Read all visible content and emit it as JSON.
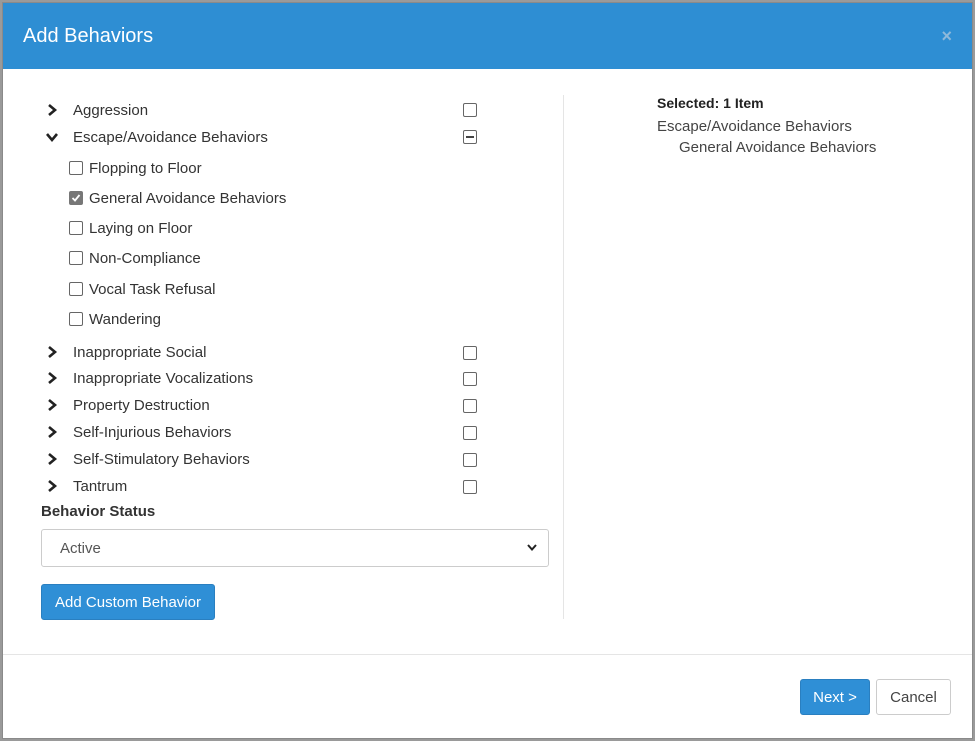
{
  "dialog": {
    "title": "Add Behaviors",
    "close_icon": "close-icon",
    "header_color": "#2e8ed3"
  },
  "tree": {
    "categories": [
      {
        "label": "Aggression",
        "expanded": false,
        "state": "unchecked"
      },
      {
        "label": "Escape/Avoidance Behaviors",
        "expanded": true,
        "state": "partial",
        "children": [
          {
            "label": "Flopping to Floor",
            "checked": false
          },
          {
            "label": "General Avoidance Behaviors",
            "checked": true
          },
          {
            "label": "Laying on Floor",
            "checked": false
          },
          {
            "label": "Non-Compliance",
            "checked": false
          },
          {
            "label": "Vocal Task Refusal",
            "checked": false
          },
          {
            "label": "Wandering",
            "checked": false
          }
        ]
      },
      {
        "label": "Inappropriate Social",
        "expanded": false,
        "state": "unchecked"
      },
      {
        "label": "Inappropriate Vocalizations",
        "expanded": false,
        "state": "unchecked"
      },
      {
        "label": "Property Destruction",
        "expanded": false,
        "state": "unchecked"
      },
      {
        "label": "Self-Injurious Behaviors",
        "expanded": false,
        "state": "unchecked"
      },
      {
        "label": "Self-Stimulatory Behaviors",
        "expanded": false,
        "state": "unchecked"
      },
      {
        "label": "Tantrum",
        "expanded": false,
        "state": "unchecked"
      }
    ]
  },
  "status": {
    "label": "Behavior Status",
    "selected": "Active"
  },
  "buttons": {
    "add_custom": "Add Custom Behavior",
    "next": "Next >",
    "cancel": "Cancel",
    "primary_color": "#2f8fd6"
  },
  "selection": {
    "title": "Selected: 1 Item",
    "category": "Escape/Avoidance Behaviors",
    "item": "General Avoidance Behaviors"
  }
}
